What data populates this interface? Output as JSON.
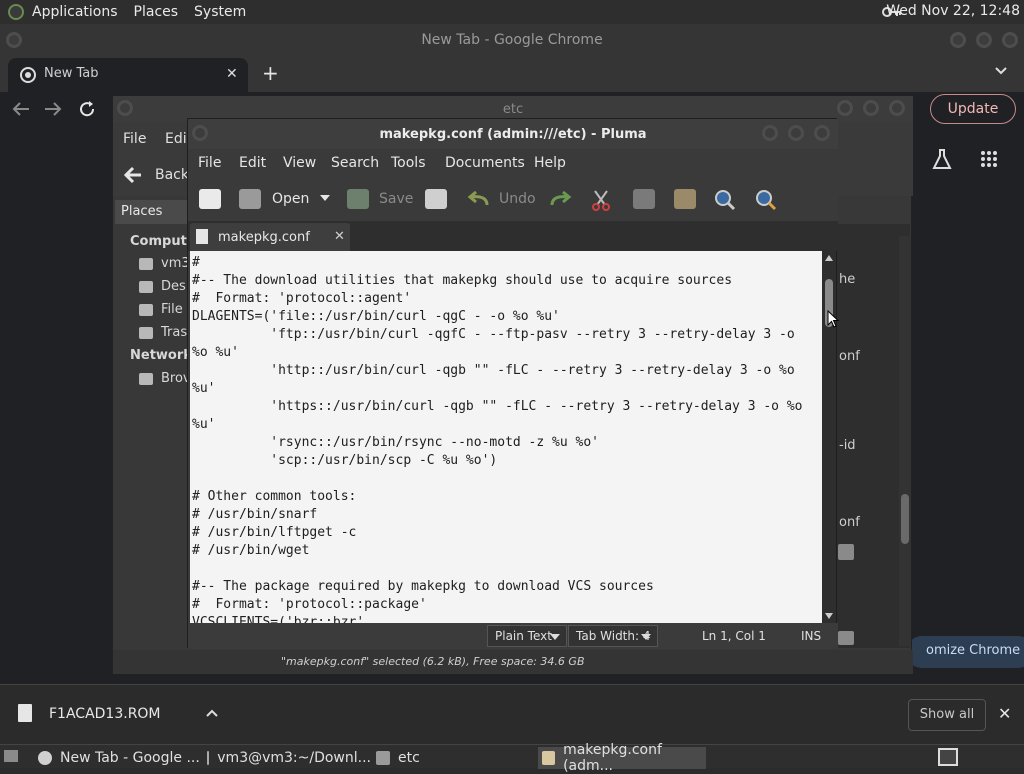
{
  "top_panel": {
    "menu": [
      "Applications",
      "Places",
      "System"
    ],
    "clock": "Wed Nov 22, 12:48"
  },
  "chrome": {
    "window_title": "New Tab - Google Chrome",
    "tab_title": "New Tab",
    "update_label": "Update",
    "customize_label": "omize Chrome"
  },
  "caja": {
    "window_title": "etc",
    "menu": [
      "File",
      "Edit"
    ],
    "back_label": "Back",
    "places_label": "Places",
    "sidebar": {
      "computer_head": "Compute",
      "items": [
        "vm3",
        "Des",
        "File",
        "Tras"
      ],
      "network_head": "Network",
      "network_items": [
        "Brov"
      ]
    },
    "main_fragments": [
      "he",
      "onf",
      "-id",
      "onf"
    ],
    "status": "\"makepkg.conf\" selected (6.2 kB), Free space: 34.6 GB"
  },
  "pluma": {
    "window_title": "makepkg.conf (admin:///etc) - Pluma",
    "menu": [
      "File",
      "Edit",
      "View",
      "Search",
      "Tools",
      "Documents",
      "Help"
    ],
    "toolbar": {
      "open": "Open",
      "save": "Save",
      "undo": "Undo"
    },
    "tab_label": "makepkg.conf",
    "lines": [
      "#",
      "#-- The download utilities that makepkg should use to acquire sources",
      "#  Format: 'protocol::agent'",
      "DLAGENTS=('file::/usr/bin/curl -qgC - -o %o %u'",
      "          'ftp::/usr/bin/curl -qgfC - --ftp-pasv --retry 3 --retry-delay 3 -o",
      "%o %u'",
      "          'http::/usr/bin/curl -qgb \"\" -fLC - --retry 3 --retry-delay 3 -o %o",
      "%u'",
      "          'https::/usr/bin/curl -qgb \"\" -fLC - --retry 3 --retry-delay 3 -o %o",
      "%u'",
      "          'rsync::/usr/bin/rsync --no-motd -z %u %o'",
      "          'scp::/usr/bin/scp -C %u %o')",
      "",
      "# Other common tools:",
      "# /usr/bin/snarf",
      "# /usr/bin/lftpget -c",
      "# /usr/bin/wget",
      "",
      "#-- The package required by makepkg to download VCS sources",
      "#  Format: 'protocol::package'",
      "VCSCLIENTS=('bzr::bzr'"
    ],
    "status": {
      "syntax": "Plain Text",
      "tab_width": "Tab Width:  4",
      "position": "Ln 1, Col 1",
      "mode": "INS"
    }
  },
  "download_bar": {
    "file_name": "F1ACAD13.ROM",
    "show_all": "Show all"
  },
  "taskbar": {
    "tasks": [
      "New Tab - Google ...",
      "vm3@vm3:~/Downl...",
      "etc",
      "makepkg.conf (adm..."
    ]
  }
}
